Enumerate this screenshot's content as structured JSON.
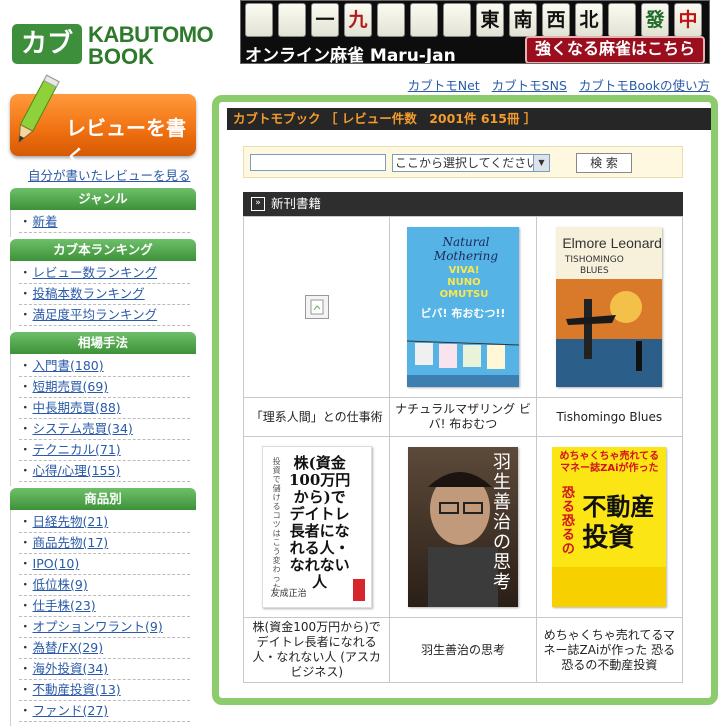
{
  "header": {
    "logo_kabu": "カブ",
    "logo_line1": "KABUTOMO",
    "logo_line2": "BOOK",
    "banner_tiles": [
      "",
      "",
      "一",
      "九",
      "",
      "",
      "",
      "東",
      "南",
      "西",
      "北",
      "",
      "發",
      "中"
    ],
    "banner_left": "オンライン麻雀 Maru-Jan",
    "banner_right": "強くなる麻雀はこちら",
    "top_links": [
      "カブトモNet",
      "カブトモSNS",
      "カブトモBookの使い方"
    ]
  },
  "sidebar": {
    "review_button": "レビューを書く",
    "own_review_link": "自分が書いたレビューを見る",
    "categories": [
      {
        "title": "ジャンル",
        "items": [
          "新着"
        ]
      },
      {
        "title": "カブ本ランキング",
        "items": [
          "レビュー数ランキング",
          "投稿本数ランキング",
          "満足度平均ランキング"
        ]
      },
      {
        "title": "相場手法",
        "items": [
          "入門書(180)",
          "短期売買(69)",
          "中長期売買(88)",
          "システム売買(34)",
          "テクニカル(71)",
          "心得/心理(155)"
        ]
      },
      {
        "title": "商品別",
        "items": [
          "日経先物(21)",
          "商品先物(17)",
          "IPO(10)",
          "低位株(9)",
          "仕手株(23)",
          "オプションワラント(9)",
          "為替/FX(29)",
          "海外投資(34)",
          "不動産投資(13)",
          "ファンド(27)"
        ]
      }
    ]
  },
  "main": {
    "title": "カブトモブック ［ レビュー件数　2001件 615冊 ］",
    "search": {
      "input_value": "",
      "select_value": "ここから選択してください",
      "button": "検 索"
    },
    "new_books_title": "新刊書籍",
    "books": [
      {
        "title": "「理系人間」との仕事術",
        "cover": "broken"
      },
      {
        "title": "ナチュラルマザリング ビバ! 布おむつ",
        "cover": "natural"
      },
      {
        "title": "Tishomingo Blues",
        "cover": "elmore"
      },
      {
        "title": "株(資金100万円から)でデイトレ長者になれる人・なれない人 (アスカビジネス)",
        "cover": "kabu"
      },
      {
        "title": "羽生善治の思考",
        "cover": "habu"
      },
      {
        "title": "めちゃくちゃ売れてるマネー誌ZAiが作った 恐る恐るの不動産投資",
        "cover": "zai"
      }
    ]
  },
  "covers": {
    "natural_top": "Natural Mothering",
    "natural_viva": "VIVA! NUNO OMUTSU",
    "natural_main": "ビバ! 布おむつ!!",
    "elmore_author": "Elmore Leonard",
    "elmore_title": "TISHOMINGO BLUES",
    "kabu_main": "株(資金100万円から)でデイトレ長者になれる人・なれない人",
    "kabu_side": "投資で儲けるコツはこう変わった",
    "kabu_author": "友成正治",
    "habu_title": "羽生善治の思考",
    "zai_top": "めちゃくちゃ売れてるマネー誌ZAiが作った",
    "zai_main1": "不動産",
    "zai_main2": "投資",
    "zai_fear": "恐る恐るの"
  }
}
